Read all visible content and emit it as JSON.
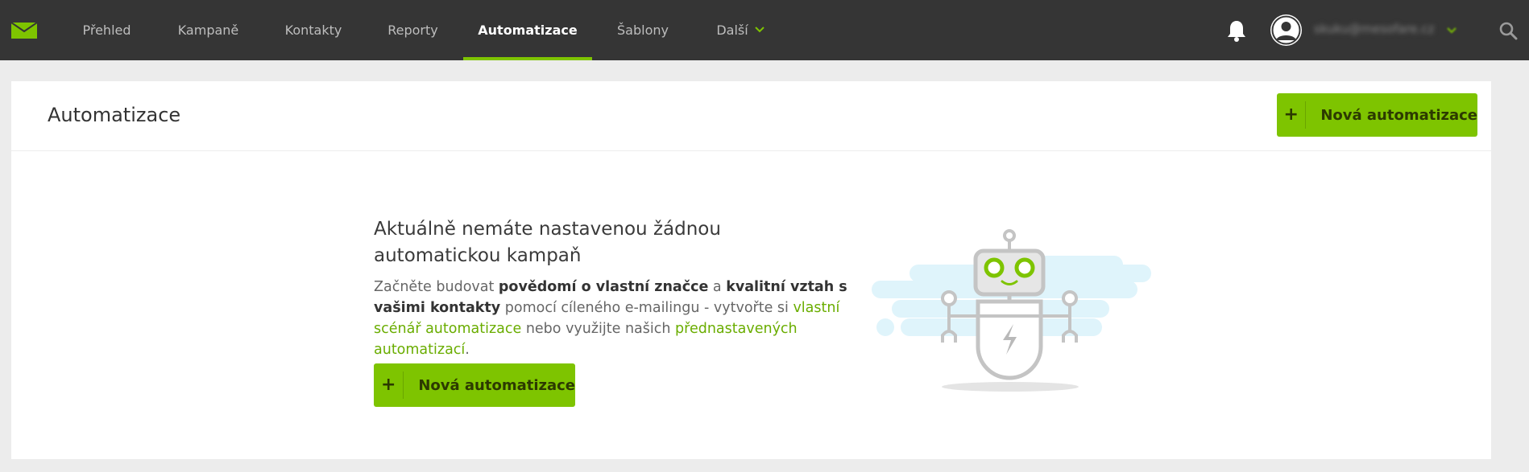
{
  "nav": {
    "items": [
      {
        "label": "Přehled"
      },
      {
        "label": "Kampaně"
      },
      {
        "label": "Kontakty"
      },
      {
        "label": "Reporty"
      },
      {
        "label": "Automatizace",
        "active": true
      },
      {
        "label": "Šablony"
      },
      {
        "label": "Další"
      }
    ]
  },
  "user": {
    "email": "skuku@mesofare.cz"
  },
  "page": {
    "title": "Automatizace",
    "new_button_label": "Nová automatizace"
  },
  "empty_state": {
    "title": "Aktuálně nemáte nastavenou žádnou automatickou kampaň",
    "desc": {
      "t1": "Začněte budovat ",
      "b1": "povědomí o vlastní značce",
      "t2": " a ",
      "b2": "kvalitní vztah s vašimi kontakty",
      "t3": " pomocí cíleného e-mailingu - vytvořte si ",
      "link1": "vlastní scénář automatizace",
      "t4": " nebo využijte našich ",
      "link2": "přednastavených automatizací",
      "t5": "."
    },
    "button_label": "Nová automatizace",
    "button_icon": "+"
  },
  "colors": {
    "topbar": "#353535",
    "accent": "#7ec400",
    "link": "#6aad00",
    "robot_cloud": "#dff4fb",
    "robot_body": "#bdbdbd"
  },
  "icons": [
    "mail-logo-icon",
    "chevron-down-icon",
    "bell-icon",
    "user-avatar-icon",
    "search-icon",
    "plus-icon",
    "robot-illustration"
  ]
}
